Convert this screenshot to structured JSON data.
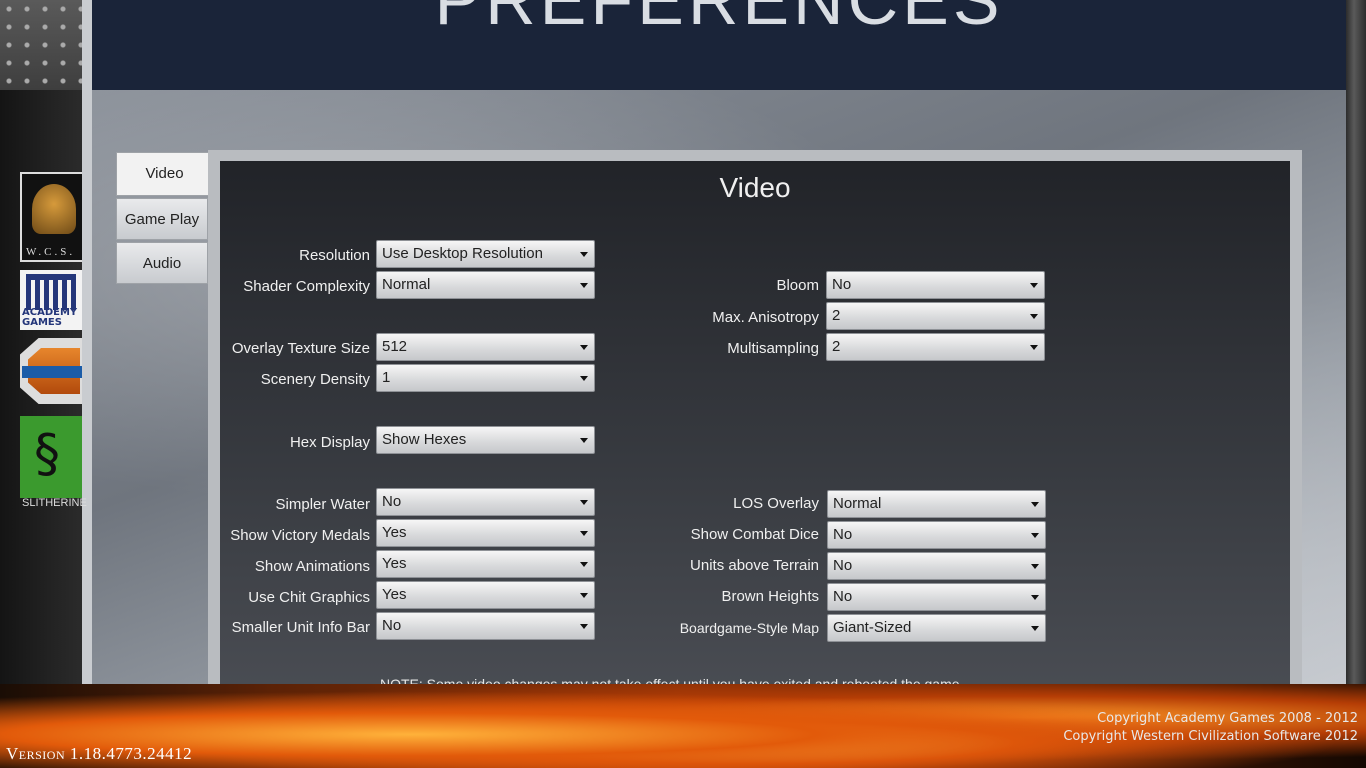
{
  "header": {
    "title": "PREFERENCES"
  },
  "tabs": [
    {
      "label": "Video",
      "active": true
    },
    {
      "label": "Game Play",
      "active": false
    },
    {
      "label": "Audio",
      "active": false
    }
  ],
  "panel": {
    "title": "Video"
  },
  "left_settings": [
    {
      "label": "Resolution",
      "value": "Use Desktop Resolution"
    },
    {
      "label": "Shader Complexity",
      "value": "Normal"
    },
    {
      "label": "Overlay Texture Size",
      "value": "512"
    },
    {
      "label": "Scenery Density",
      "value": "1"
    },
    {
      "label": "Hex Display",
      "value": "Show Hexes"
    },
    {
      "label": "Simpler Water",
      "value": "No"
    },
    {
      "label": "Show Victory Medals",
      "value": "Yes"
    },
    {
      "label": "Show Animations",
      "value": "Yes"
    },
    {
      "label": "Use Chit Graphics",
      "value": "Yes"
    },
    {
      "label": "Smaller Unit Info Bar",
      "value": "No"
    }
  ],
  "right_settings": [
    {
      "label": "Bloom",
      "value": "No"
    },
    {
      "label": "Max. Anisotropy",
      "value": "2"
    },
    {
      "label": "Multisampling",
      "value": "2"
    },
    {
      "label": "LOS Overlay",
      "value": "Normal"
    },
    {
      "label": "Show Combat Dice",
      "value": "No"
    },
    {
      "label": "Units above Terrain",
      "value": "No"
    },
    {
      "label": "Brown Heights",
      "value": "No"
    },
    {
      "label": "Boardgame-Style Map",
      "value": "Giant-Sized"
    }
  ],
  "note": "NOTE: Some video changes may not take effect until you have exited and rebooted the game.",
  "logos": {
    "wcs": "W.C.S.",
    "academy": "ACADEMY GAMES",
    "matrix": "matrix games",
    "slitherine": "SLITHERINE"
  },
  "footer": {
    "version": "Version 1.18.4773.24412",
    "copyright_1": "Copyright Academy Games 2008 - 2012",
    "copyright_2": "Copyright Western Civilization Software 2012"
  }
}
